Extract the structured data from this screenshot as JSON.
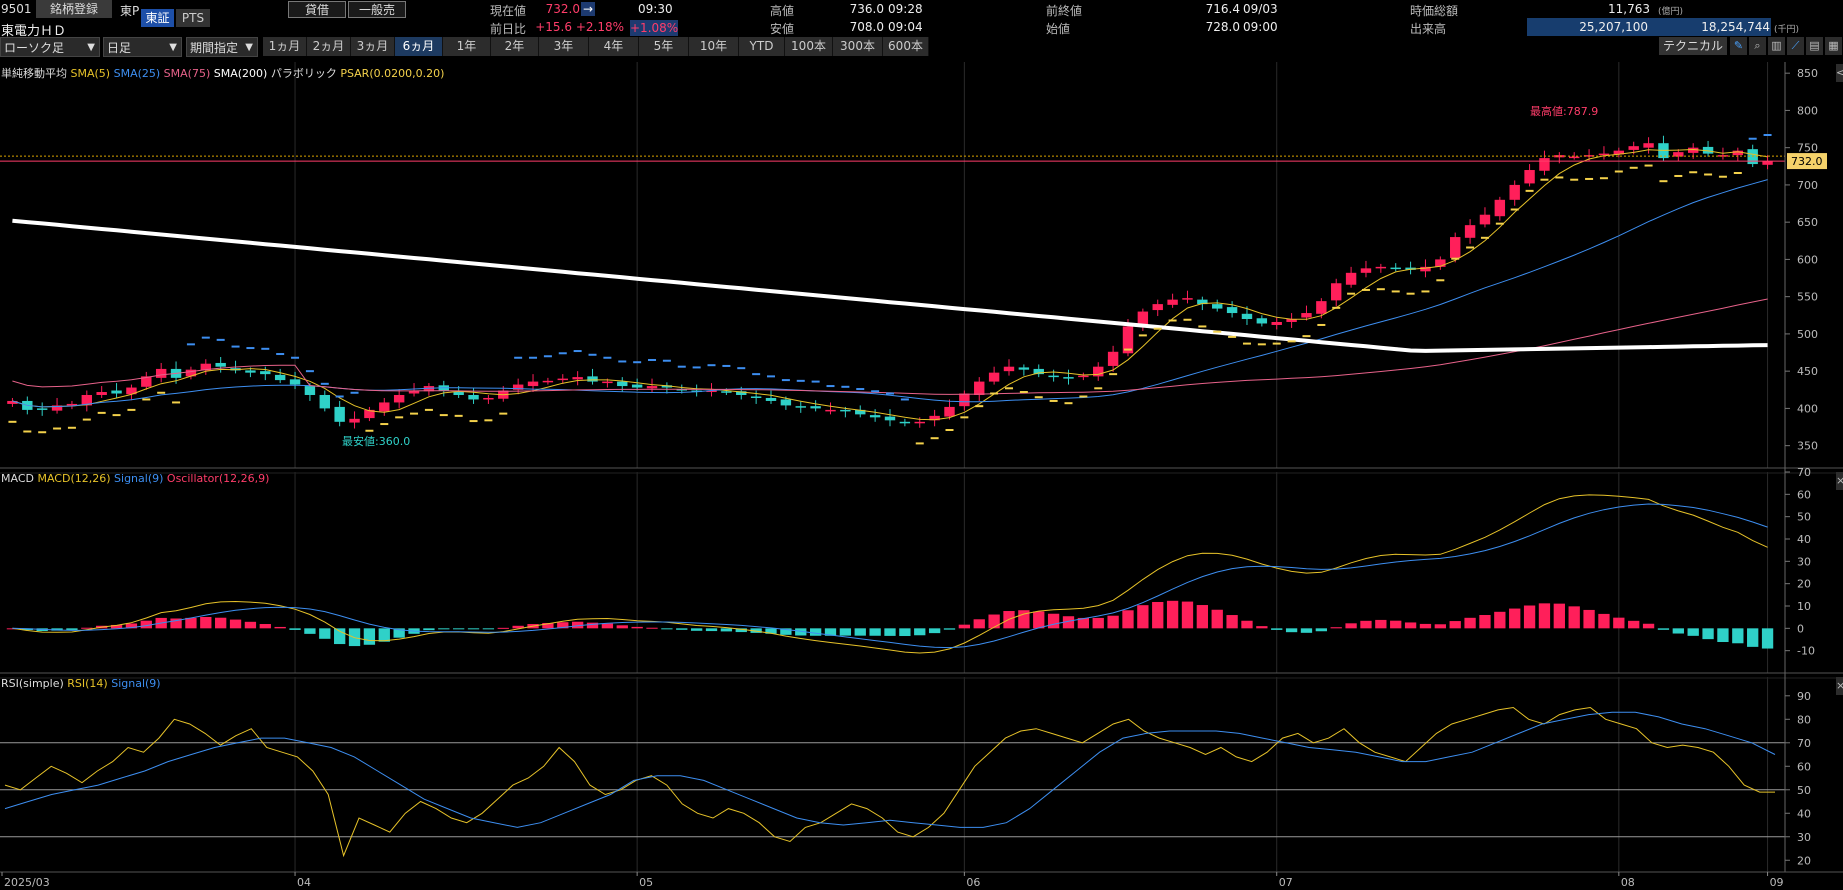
{
  "header": {
    "code": "9501",
    "register_label": "銘柄登録",
    "market_code": "東P",
    "name": "東電力ＨＤ",
    "exchange_tabs": [
      "東証",
      "PTS"
    ],
    "trade_buttons": [
      "貸借",
      "一般売"
    ],
    "current_label": "現在値",
    "current_value": "732.0",
    "current_arrow": "→",
    "current_time": "09:30",
    "change_label": "前日比",
    "change_value": "+15.6",
    "change_pct": "+2.18%",
    "change_pct2": "+1.08%",
    "high_label": "高値",
    "high_value": "736.0",
    "high_time": "09:28",
    "low_label": "安値",
    "low_value": "708.0",
    "low_time": "09:04",
    "prev_close_label": "前終値",
    "prev_close_value": "716.4",
    "prev_close_date": "09/03",
    "open_label": "始値",
    "open_value": "728.0",
    "open_time": "09:00",
    "mcap_label": "時価総額",
    "mcap_value": "11,763",
    "mcap_unit": "(億円)",
    "volume_label": "出来高",
    "volume_value": "25,207,100",
    "turnover_value": "18,254,744",
    "turnover_unit": "(千円)"
  },
  "toolbar": {
    "chart_type": "ローソク足",
    "interval": "日足",
    "period_select": "期間指定",
    "periods": [
      "1ヵ月",
      "2ヵ月",
      "3ヵ月",
      "6ヵ月",
      "1年",
      "2年",
      "3年",
      "4年",
      "5年",
      "10年",
      "YTD",
      "100本",
      "300本",
      "600本"
    ],
    "active_period": "6ヵ月",
    "technical_label": "テクニカル"
  },
  "colors": {
    "up": "#ff1f5a",
    "down": "#2fd1c8",
    "sma5": "#e6c229",
    "sma25": "#3d8ef0",
    "sma75": "#e7628a",
    "sma200": "#ffffff",
    "psar": "#f3d14b",
    "macd": "#e6c229",
    "signal": "#3d8ef0",
    "osc": "#ff1f5a"
  },
  "chart_data": [
    {
      "type": "candlestick",
      "legend": [
        "単純移動平均",
        "SMA(5)",
        "SMA(25)",
        "SMA(75)",
        "SMA(200)",
        "パラボリック",
        "PSAR(0.0200,0.20)"
      ],
      "ylim": [
        320,
        865
      ],
      "yticks": [
        350,
        400,
        450,
        500,
        550,
        600,
        650,
        700,
        750,
        800,
        850
      ],
      "x_labels": [
        "2025/03",
        "04",
        "05",
        "06",
        "07",
        "08",
        "09"
      ],
      "last_price_label": "732.0",
      "max_annotation": "最高値:787.9",
      "min_annotation": "最安値:360.0",
      "sample_close": [
        410,
        398,
        398,
        404,
        406,
        418,
        422,
        420,
        428,
        443,
        453,
        441,
        452,
        460,
        456,
        451,
        448,
        446,
        438,
        432,
        418,
        400,
        382,
        386,
        398,
        408,
        418,
        424,
        430,
        424,
        418,
        412,
        414,
        424,
        432,
        436,
        437,
        440,
        442,
        436,
        436,
        430,
        428,
        430,
        428,
        424,
        422,
        424,
        422,
        418,
        414,
        410,
        404,
        402,
        400,
        398,
        396,
        392,
        388,
        384,
        380,
        382,
        390,
        402,
        420,
        436,
        448,
        456,
        452,
        446,
        442,
        440,
        444,
        456,
        476,
        510,
        530,
        540,
        546,
        548,
        540,
        534,
        528,
        520,
        514,
        516,
        520,
        528,
        544,
        568,
        582,
        588,
        590,
        588,
        586,
        590,
        600,
        630,
        646,
        660,
        680,
        700,
        720,
        736,
        740,
        738,
        740,
        742,
        746,
        752,
        756,
        736,
        744,
        750,
        742,
        740,
        746,
        728,
        732
      ]
    },
    {
      "type": "line_bar",
      "legend": [
        "MACD",
        "MACD(12,26)",
        "Signal(9)",
        "Oscillator(12,26,9)"
      ],
      "ylim": [
        -20,
        70
      ],
      "yticks": [
        -10,
        0,
        10,
        20,
        30,
        40,
        50,
        60,
        70
      ]
    },
    {
      "type": "line",
      "legend": [
        "RSI(simple)",
        "RSI(14)",
        "Signal(9)"
      ],
      "ylim": [
        15,
        98
      ],
      "yticks": [
        20,
        30,
        40,
        50,
        60,
        70,
        80,
        90
      ],
      "hlines": [
        30,
        50,
        70
      ],
      "rsi": [
        52,
        50,
        55,
        60,
        57,
        53,
        58,
        62,
        68,
        66,
        72,
        80,
        78,
        74,
        69,
        73,
        76,
        68,
        66,
        64,
        58,
        48,
        22,
        38,
        35,
        32,
        40,
        45,
        42,
        38,
        36,
        40,
        46,
        52,
        55,
        60,
        68,
        62,
        52,
        48,
        50,
        54,
        56,
        52,
        44,
        40,
        38,
        42,
        40,
        36,
        30,
        28,
        34,
        36,
        40,
        44,
        42,
        38,
        32,
        30,
        34,
        40,
        50,
        60,
        66,
        72,
        75,
        76,
        74,
        72,
        70,
        74,
        78,
        80,
        75,
        72,
        70,
        68,
        65,
        68,
        64,
        62,
        66,
        72,
        74,
        70,
        72,
        76,
        70,
        66,
        64,
        62,
        68,
        74,
        78,
        80,
        82,
        84,
        85,
        80,
        78,
        82,
        84,
        85,
        80,
        78,
        76,
        70,
        68,
        69,
        68,
        66,
        60,
        52,
        49,
        49
      ],
      "rsi_signal": [
        42,
        45,
        48,
        50,
        52,
        55,
        58,
        62,
        65,
        68,
        70,
        72,
        72,
        70,
        68,
        64,
        58,
        52,
        46,
        42,
        38,
        36,
        34,
        36,
        40,
        44,
        48,
        54,
        56,
        56,
        54,
        50,
        46,
        42,
        38,
        36,
        35,
        36,
        37,
        36,
        35,
        34,
        34,
        36,
        42,
        50,
        58,
        66,
        72,
        74,
        75,
        75,
        75,
        74,
        72,
        70,
        68,
        67,
        66,
        64,
        62,
        62,
        64,
        66,
        70,
        74,
        78,
        80,
        82,
        83,
        83,
        81,
        78,
        76,
        73,
        70,
        65
      ]
    }
  ]
}
